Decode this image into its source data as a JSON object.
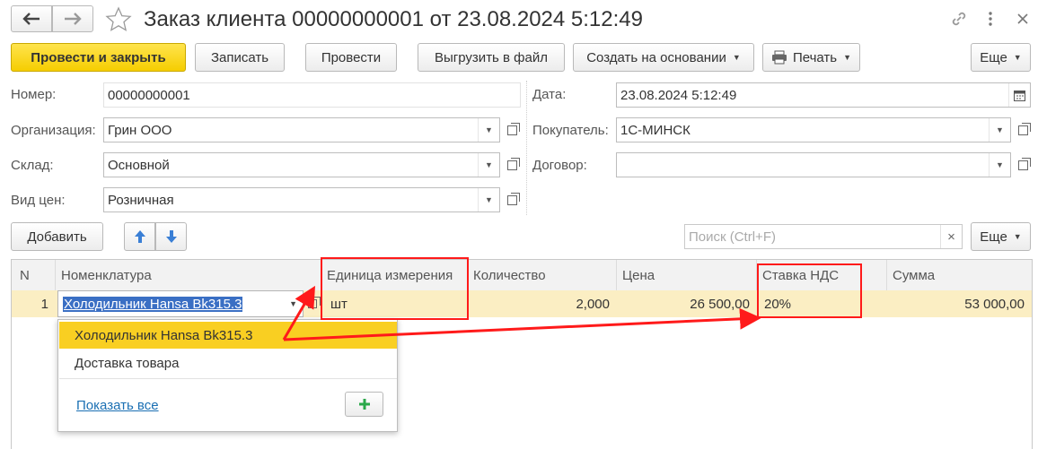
{
  "window": {
    "title": "Заказ клиента 00000000001 от 23.08.2024 5:12:49",
    "back_icon": "arrow-left-icon",
    "forward_icon": "arrow-right-icon",
    "star_icon": "star-icon",
    "link_icon": "link-icon",
    "more_icon": "more-vertical-icon",
    "close_icon": "close-icon"
  },
  "toolbar": {
    "post_close": "Провести и закрыть",
    "write": "Записать",
    "post": "Провести",
    "export": "Выгрузить в файл",
    "create_based": "Создать на основании",
    "print": "Печать",
    "more": "Еще"
  },
  "form": {
    "number_label": "Номер:",
    "number_value": "00000000001",
    "org_label": "Организация:",
    "org_value": "Грин ООО",
    "warehouse_label": "Склад:",
    "warehouse_value": "Основной",
    "price_type_label": "Вид цен:",
    "price_type_value": "Розничная",
    "date_label": "Дата:",
    "date_value": "23.08.2024  5:12:49",
    "customer_label": "Покупатель:",
    "customer_value": "1С-МИНСК",
    "contract_label": "Договор:",
    "contract_value": ""
  },
  "table_toolbar": {
    "add": "Добавить",
    "search_placeholder": "Поиск (Ctrl+F)",
    "more": "Еще"
  },
  "table": {
    "headers": [
      "N",
      "Номенклатура",
      "Единица измерения",
      "Количество",
      "Цена",
      "Ставка НДС",
      "Сумма"
    ],
    "rows": [
      {
        "n": "1",
        "item": "Холодильник Hansa Bk315.3",
        "unit": "шт",
        "qty": "2,000",
        "price": "26 500,00",
        "vat": "20%",
        "sum": "53 000,00"
      }
    ]
  },
  "dropdown": {
    "items": [
      "Холодильник Hansa Bk315.3",
      "Доставка товара"
    ],
    "show_all": "Показать все",
    "add_icon": "plus-icon"
  },
  "colors": {
    "primary_button": "#f5cd00",
    "row_highlight": "#fbeec3",
    "annotation": "#ff1a1a",
    "link": "#1a6fb3"
  }
}
